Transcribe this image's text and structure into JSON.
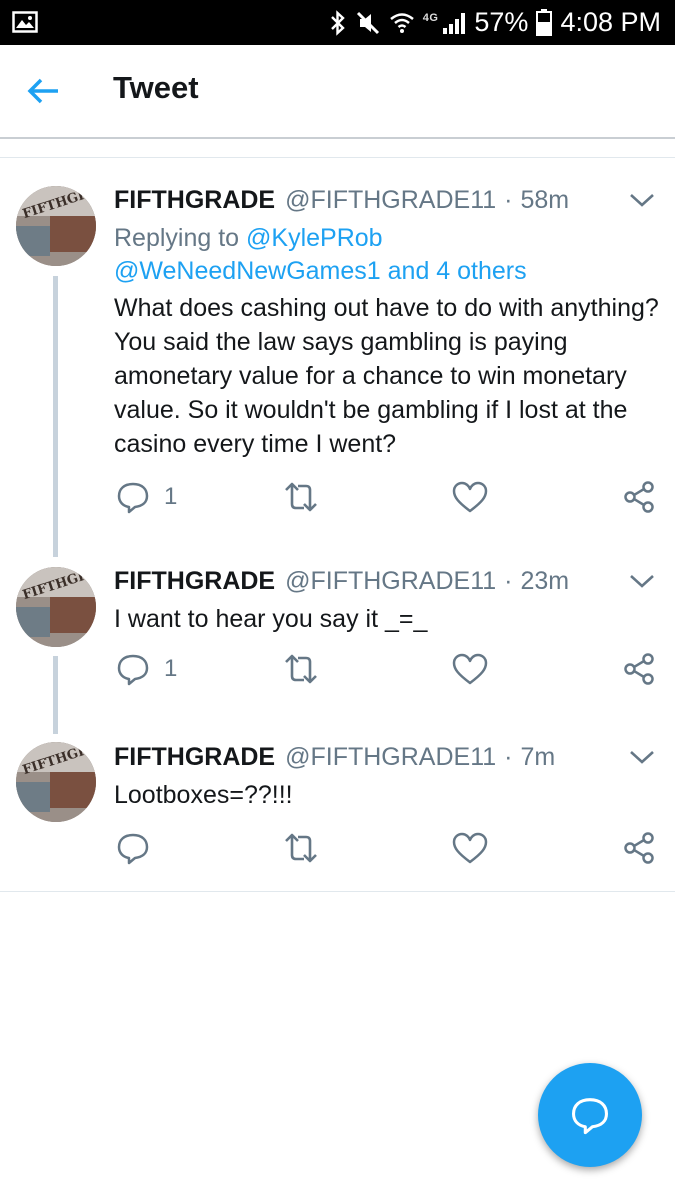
{
  "status_bar": {
    "network": "4G",
    "battery": "57%",
    "time": "4:08 PM"
  },
  "header": {
    "title": "Tweet",
    "back_icon": "arrow-left-icon"
  },
  "colors": {
    "accent": "#1da1f2",
    "secondary_text": "#657786",
    "primary_text": "#14171a",
    "thread_line": "#c7d2dc"
  },
  "tweets": [
    {
      "name": "FIFTHGRADE",
      "handle": "@FIFTHGRADE11",
      "separator": "·",
      "time": "58m",
      "reply_prefix": "Replying to",
      "reply_to_line1": "@KylePRob",
      "reply_to_line2": "@WeNeedNewGames1 and 4 others",
      "text": "What does cashing out have to do with anything? You said the law says gambling is paying amonetary value for  a chance to win monetary value. So it wouldn't be gambling if I lost at the casino every time I went?",
      "reply_count": "1"
    },
    {
      "name": "FIFTHGRADE",
      "handle": "@FIFTHGRADE11",
      "separator": "·",
      "time": "23m",
      "text": "I want to hear you say it _=_",
      "reply_count": "1"
    },
    {
      "name": "FIFTHGRADE",
      "handle": "@FIFTHGRADE11",
      "separator": "·",
      "time": "7m",
      "text": "Lootboxes=??!!!",
      "reply_count": ""
    }
  ],
  "icons": {
    "reply": "reply-icon",
    "retweet": "retweet-icon",
    "like": "heart-icon",
    "share": "share-icon",
    "compose": "compose-reply-icon"
  }
}
